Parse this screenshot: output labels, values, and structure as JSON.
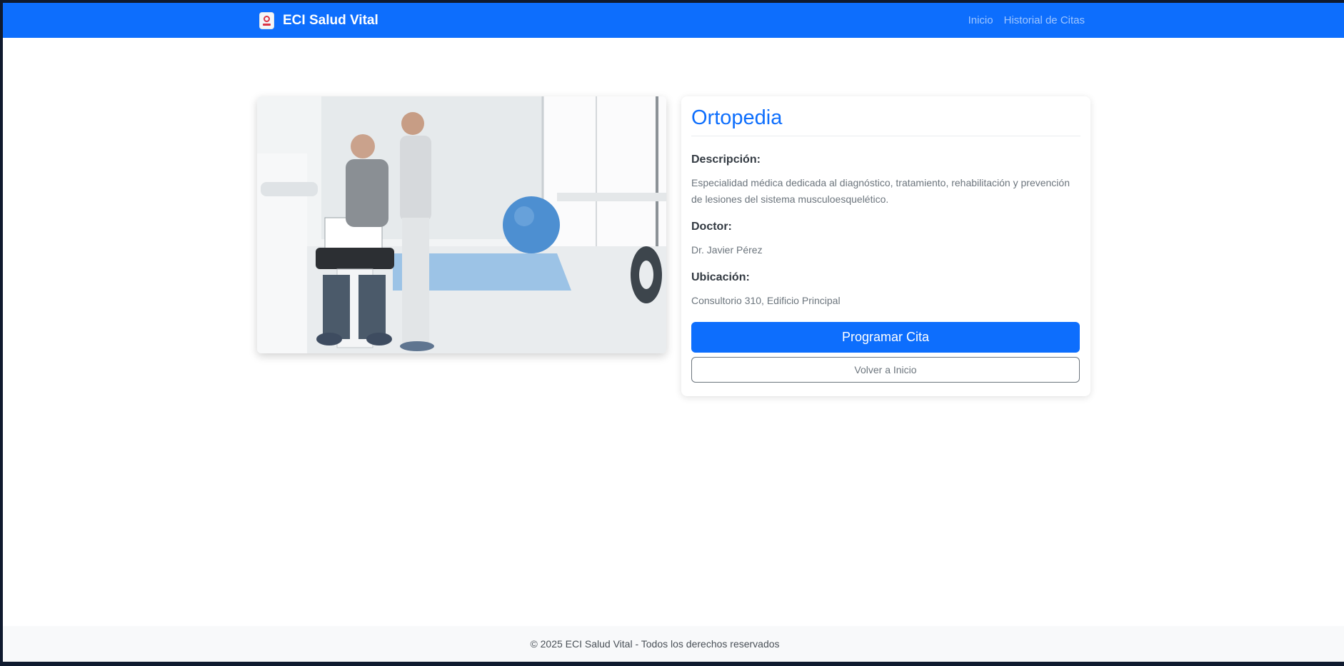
{
  "brand": {
    "name": "ECI Salud Vital"
  },
  "nav": {
    "items": [
      {
        "label": "Inicio"
      },
      {
        "label": "Historial de Citas"
      }
    ]
  },
  "specialty": {
    "title": "Ortopedia",
    "image_alt": "Fisioterapeuta ayudando a un paciente en una máquina de rehabilitación",
    "description_label": "Descripción:",
    "description": "Especialidad médica dedicada al diagnóstico, tratamiento, rehabilitación y prevención de lesiones del sistema musculoesquelético.",
    "doctor_label": "Doctor:",
    "doctor": "Dr. Javier Pérez",
    "location_label": "Ubicación:",
    "location": "Consultorio 310, Edificio Principal"
  },
  "actions": {
    "schedule": "Programar Cita",
    "back": "Volver a Inicio"
  },
  "footer": {
    "text": "© 2025 ECI Salud Vital - Todos los derechos reservados"
  },
  "colors": {
    "primary": "#0d6efd",
    "muted": "#6c757d",
    "footer_bg": "#f8f9fa"
  }
}
